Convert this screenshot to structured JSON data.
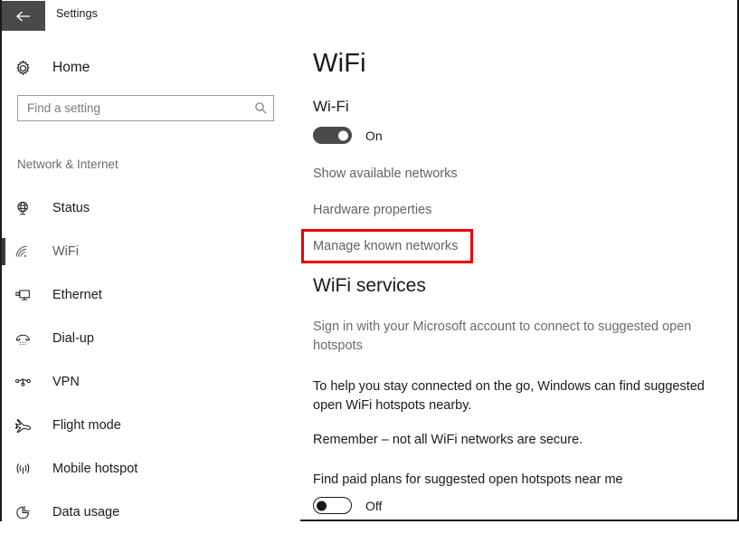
{
  "titlebar": {
    "back_label": "Back",
    "back_icon": "arrow-left-icon",
    "title": "Settings"
  },
  "sidebar": {
    "home": {
      "label": "Home",
      "icon": "gear-icon"
    },
    "search": {
      "value": "",
      "placeholder": "Find a setting",
      "icon": "search-icon"
    },
    "section_label": "Network & Internet",
    "items": [
      {
        "label": "Status",
        "icon": "status-globe-icon",
        "selected": false
      },
      {
        "label": "WiFi",
        "icon": "wifi-icon",
        "selected": true
      },
      {
        "label": "Ethernet",
        "icon": "ethernet-icon",
        "selected": false
      },
      {
        "label": "Dial-up",
        "icon": "dialup-phone-icon",
        "selected": false
      },
      {
        "label": "VPN",
        "icon": "vpn-icon",
        "selected": false
      },
      {
        "label": "Flight mode",
        "icon": "airplane-icon",
        "selected": false
      },
      {
        "label": "Mobile hotspot",
        "icon": "broadcast-antenna-icon",
        "selected": false
      },
      {
        "label": "Data usage",
        "icon": "pie-chart-icon",
        "selected": false
      }
    ]
  },
  "main": {
    "page_title": "WiFi",
    "wifi_section": {
      "heading": "Wi-Fi",
      "toggle_state": "On",
      "toggle_on": true
    },
    "links": [
      {
        "label": "Show available networks"
      },
      {
        "label": "Hardware properties"
      },
      {
        "label": "Manage known networks",
        "highlighted": true
      }
    ],
    "services": {
      "heading": "WiFi services",
      "paragraph_1": "Sign in with your Microsoft account to connect to suggested open hotspots",
      "paragraph_2": "To help you stay connected on the go, Windows can find suggested open WiFi hotspots nearby.",
      "paragraph_3": "Remember – not all WiFi networks are secure.",
      "paid_plans_label": "Find paid plans for suggested open hotspots near me",
      "paid_plans_state": "Off",
      "paid_plans_on": false
    }
  },
  "colors": {
    "highlight_red": "#ee0000",
    "titlebar_back_bg": "#4c4a48",
    "selection_bar": "#3a3a3a",
    "link_text": "#636363",
    "muted_text": "#6b6b6b"
  }
}
